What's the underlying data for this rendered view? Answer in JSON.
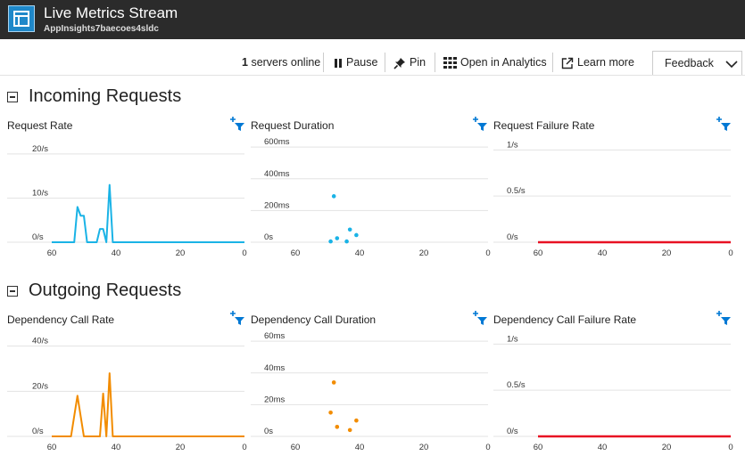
{
  "app": {
    "title": "Live Metrics Stream",
    "subtitle": "AppInsights7baecoes4sldc",
    "icon": "live-metrics-icon"
  },
  "toolbar": {
    "servers_count": "1",
    "servers_label": "servers online",
    "pause_label": "Pause",
    "pin_label": "Pin",
    "analytics_label": "Open in Analytics",
    "learn_label": "Learn more",
    "feedback_label": "Feedback"
  },
  "sections": {
    "incoming": {
      "title": "Incoming Requests"
    },
    "outgoing": {
      "title": "Outgoing Requests"
    }
  },
  "colors": {
    "incoming": "#1ab3e6",
    "outgoing": "#f28c00",
    "failure": "#e81123",
    "filter_icon": "#0078d4"
  },
  "chart_data": [
    {
      "id": "request-rate",
      "type": "line",
      "title": "Request Rate",
      "x": [
        60,
        59,
        58,
        57,
        56,
        55,
        54,
        53,
        52,
        51,
        50,
        49,
        48,
        47,
        46,
        45,
        44,
        43,
        42,
        41,
        40,
        39,
        38,
        37,
        36,
        35,
        30,
        25,
        20,
        15,
        10,
        5,
        0
      ],
      "values": [
        0,
        0,
        0,
        0,
        0,
        0,
        0,
        0,
        8,
        6,
        6,
        0,
        0,
        0,
        0,
        3,
        3,
        0,
        13,
        0,
        0,
        0,
        0,
        0,
        0,
        0,
        0,
        0,
        0,
        0,
        0,
        0,
        0
      ],
      "color_key": "incoming",
      "xlim": [
        60,
        0
      ],
      "ylim": [
        0,
        23
      ],
      "xticks": [
        "60",
        "40",
        "20",
        "0"
      ],
      "yticks": [
        "0/s",
        "10/s",
        "20/s"
      ],
      "ytick_values": [
        0,
        10,
        20
      ]
    },
    {
      "id": "request-duration",
      "type": "scatter",
      "title": "Request Duration",
      "x": [
        49,
        48,
        47,
        44,
        43,
        41
      ],
      "values": [
        5,
        290,
        25,
        5,
        80,
        45
      ],
      "color_key": "incoming",
      "xlim": [
        60,
        0
      ],
      "ylim": [
        0,
        640
      ],
      "xticks": [
        "60",
        "40",
        "20",
        "0"
      ],
      "yticks": [
        "0s",
        "200ms",
        "400ms",
        "600ms"
      ],
      "ytick_values": [
        0,
        200,
        400,
        600
      ]
    },
    {
      "id": "request-failure-rate",
      "type": "line",
      "title": "Request Failure Rate",
      "x": [
        60,
        0
      ],
      "values": [
        0,
        0
      ],
      "color_key": "failure",
      "xlim": [
        60,
        0
      ],
      "ylim": [
        0,
        1.1
      ],
      "xticks": [
        "60",
        "40",
        "20",
        "0"
      ],
      "yticks": [
        "0/s",
        "0.5/s",
        "1/s"
      ],
      "ytick_values": [
        0,
        0.5,
        1
      ]
    },
    {
      "id": "dependency-call-rate",
      "type": "line",
      "title": "Dependency Call Rate",
      "x": [
        60,
        59,
        58,
        57,
        56,
        55,
        54,
        53,
        52,
        51,
        50,
        49,
        48,
        47,
        46,
        45,
        44,
        43,
        42,
        41,
        40,
        39,
        38,
        37,
        36,
        35,
        30,
        25,
        20,
        15,
        10,
        5,
        0
      ],
      "values": [
        0,
        0,
        0,
        0,
        0,
        0,
        0,
        9,
        18,
        9,
        0,
        0,
        0,
        0,
        0,
        0,
        19,
        0,
        28,
        0,
        0,
        0,
        0,
        0,
        0,
        0,
        0,
        0,
        0,
        0,
        0,
        0,
        0
      ],
      "color_key": "outgoing",
      "xlim": [
        60,
        0
      ],
      "ylim": [
        0,
        45
      ],
      "xticks": [
        "60",
        "40",
        "20",
        "0"
      ],
      "yticks": [
        "0/s",
        "20/s",
        "40/s"
      ],
      "ytick_values": [
        0,
        20,
        40
      ]
    },
    {
      "id": "dependency-call-duration",
      "type": "scatter",
      "title": "Dependency Call Duration",
      "x": [
        49,
        48,
        47,
        43,
        41
      ],
      "values": [
        15,
        34,
        6,
        4,
        10
      ],
      "color_key": "outgoing",
      "xlim": [
        60,
        0
      ],
      "ylim": [
        0,
        64
      ],
      "xticks": [
        "60",
        "40",
        "20",
        "0"
      ],
      "yticks": [
        "0s",
        "20ms",
        "40ms",
        "60ms"
      ],
      "ytick_values": [
        0,
        20,
        40,
        60
      ]
    },
    {
      "id": "dependency-call-failure-rate",
      "type": "line",
      "title": "Dependency Call Failure Rate",
      "x": [
        60,
        0
      ],
      "values": [
        0,
        0
      ],
      "color_key": "failure",
      "xlim": [
        60,
        0
      ],
      "ylim": [
        0,
        1.1
      ],
      "xticks": [
        "60",
        "40",
        "20",
        "0"
      ],
      "yticks": [
        "0/s",
        "0.5/s",
        "1/s"
      ],
      "ytick_values": [
        0,
        0.5,
        1
      ]
    }
  ]
}
